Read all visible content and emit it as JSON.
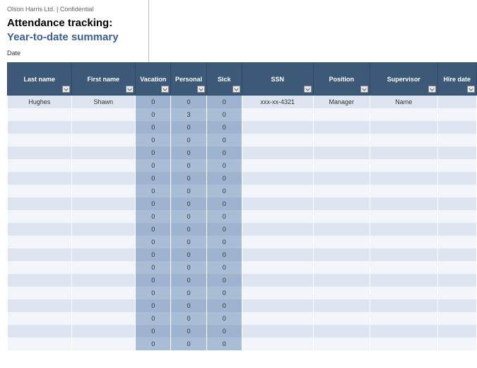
{
  "header": {
    "confidential": "Olson Harris Ltd. | Confidential",
    "title1": "Attendance tracking:",
    "title2": "Year-to-date summary",
    "date_label": "Date"
  },
  "columns": {
    "lastname": "Last name",
    "firstname": "First name",
    "vacation": "Vacation",
    "personal": "Personal",
    "sick": "Sick",
    "ssn": "SSN",
    "position": "Position",
    "supervisor": "Supervisor",
    "hiredate": "Hire date"
  },
  "rows": [
    {
      "lastname": "Hughes",
      "firstname": "Shawn",
      "vacation": "0",
      "personal": "0",
      "sick": "0",
      "ssn": "xxx-xx-4321",
      "position": "Manager",
      "supervisor": "Name",
      "hiredate": ""
    },
    {
      "lastname": "",
      "firstname": "",
      "vacation": "0",
      "personal": "3",
      "sick": "0",
      "ssn": "",
      "position": "",
      "supervisor": "",
      "hiredate": ""
    },
    {
      "lastname": "",
      "firstname": "",
      "vacation": "0",
      "personal": "0",
      "sick": "0",
      "ssn": "",
      "position": "",
      "supervisor": "",
      "hiredate": ""
    },
    {
      "lastname": "",
      "firstname": "",
      "vacation": "0",
      "personal": "0",
      "sick": "0",
      "ssn": "",
      "position": "",
      "supervisor": "",
      "hiredate": ""
    },
    {
      "lastname": "",
      "firstname": "",
      "vacation": "0",
      "personal": "0",
      "sick": "0",
      "ssn": "",
      "position": "",
      "supervisor": "",
      "hiredate": ""
    },
    {
      "lastname": "",
      "firstname": "",
      "vacation": "0",
      "personal": "0",
      "sick": "0",
      "ssn": "",
      "position": "",
      "supervisor": "",
      "hiredate": ""
    },
    {
      "lastname": "",
      "firstname": "",
      "vacation": "0",
      "personal": "0",
      "sick": "0",
      "ssn": "",
      "position": "",
      "supervisor": "",
      "hiredate": ""
    },
    {
      "lastname": "",
      "firstname": "",
      "vacation": "0",
      "personal": "0",
      "sick": "0",
      "ssn": "",
      "position": "",
      "supervisor": "",
      "hiredate": ""
    },
    {
      "lastname": "",
      "firstname": "",
      "vacation": "0",
      "personal": "0",
      "sick": "0",
      "ssn": "",
      "position": "",
      "supervisor": "",
      "hiredate": ""
    },
    {
      "lastname": "",
      "firstname": "",
      "vacation": "0",
      "personal": "0",
      "sick": "0",
      "ssn": "",
      "position": "",
      "supervisor": "",
      "hiredate": ""
    },
    {
      "lastname": "",
      "firstname": "",
      "vacation": "0",
      "personal": "0",
      "sick": "0",
      "ssn": "",
      "position": "",
      "supervisor": "",
      "hiredate": ""
    },
    {
      "lastname": "",
      "firstname": "",
      "vacation": "0",
      "personal": "0",
      "sick": "0",
      "ssn": "",
      "position": "",
      "supervisor": "",
      "hiredate": ""
    },
    {
      "lastname": "",
      "firstname": "",
      "vacation": "0",
      "personal": "0",
      "sick": "0",
      "ssn": "",
      "position": "",
      "supervisor": "",
      "hiredate": ""
    },
    {
      "lastname": "",
      "firstname": "",
      "vacation": "0",
      "personal": "0",
      "sick": "0",
      "ssn": "",
      "position": "",
      "supervisor": "",
      "hiredate": ""
    },
    {
      "lastname": "",
      "firstname": "",
      "vacation": "0",
      "personal": "0",
      "sick": "0",
      "ssn": "",
      "position": "",
      "supervisor": "",
      "hiredate": ""
    },
    {
      "lastname": "",
      "firstname": "",
      "vacation": "0",
      "personal": "0",
      "sick": "0",
      "ssn": "",
      "position": "",
      "supervisor": "",
      "hiredate": ""
    },
    {
      "lastname": "",
      "firstname": "",
      "vacation": "0",
      "personal": "0",
      "sick": "0",
      "ssn": "",
      "position": "",
      "supervisor": "",
      "hiredate": ""
    },
    {
      "lastname": "",
      "firstname": "",
      "vacation": "0",
      "personal": "0",
      "sick": "0",
      "ssn": "",
      "position": "",
      "supervisor": "",
      "hiredate": ""
    },
    {
      "lastname": "",
      "firstname": "",
      "vacation": "0",
      "personal": "0",
      "sick": "0",
      "ssn": "",
      "position": "",
      "supervisor": "",
      "hiredate": ""
    },
    {
      "lastname": "",
      "firstname": "",
      "vacation": "0",
      "personal": "0",
      "sick": "0",
      "ssn": "",
      "position": "",
      "supervisor": "",
      "hiredate": ""
    }
  ]
}
